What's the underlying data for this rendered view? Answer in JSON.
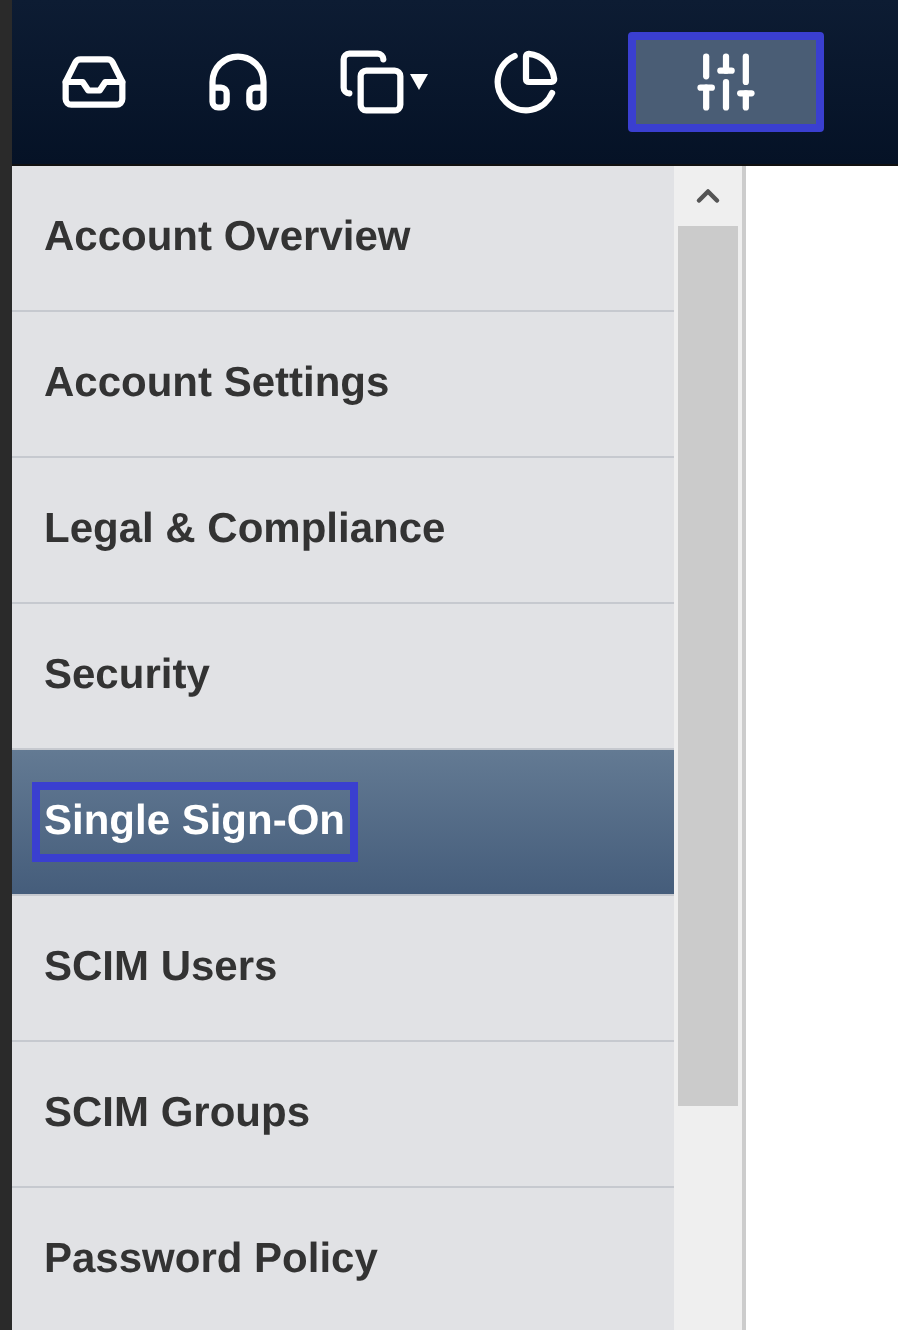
{
  "toolbar": {
    "items": [
      {
        "kind": "inbox",
        "selected": false
      },
      {
        "kind": "headset",
        "selected": false
      },
      {
        "kind": "copy",
        "selected": false,
        "dropdown": true
      },
      {
        "kind": "pie",
        "selected": false
      },
      {
        "kind": "sliders",
        "selected": true
      }
    ]
  },
  "menu": {
    "items": [
      {
        "label": "Account Overview",
        "selected": false
      },
      {
        "label": "Account Settings",
        "selected": false
      },
      {
        "label": "Legal & Compliance",
        "selected": false
      },
      {
        "label": "Security",
        "selected": false
      },
      {
        "label": "Single Sign-On",
        "selected": true
      },
      {
        "label": "SCIM Users",
        "selected": false
      },
      {
        "label": "SCIM Groups",
        "selected": false
      },
      {
        "label": "Password Policy",
        "selected": false
      }
    ]
  }
}
